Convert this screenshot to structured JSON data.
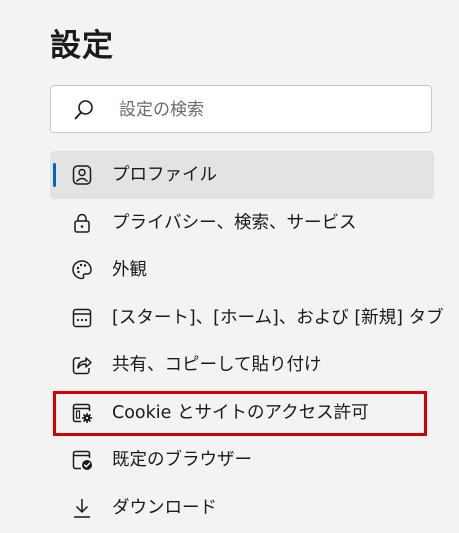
{
  "header": {
    "title": "設定"
  },
  "search": {
    "placeholder": "設定の検索"
  },
  "nav": {
    "items": [
      {
        "label": "プロファイル",
        "icon": "profile-icon",
        "selected": true
      },
      {
        "label": "プライバシー、検索、サービス",
        "icon": "lock-icon"
      },
      {
        "label": "外観",
        "icon": "palette-icon"
      },
      {
        "label": "[スタート]、[ホーム]、および [新規] タブ",
        "icon": "start-page-icon"
      },
      {
        "label": "共有、コピーして貼り付け",
        "icon": "share-icon"
      },
      {
        "label": "Cookie とサイトのアクセス許可",
        "icon": "site-permissions-icon",
        "highlighted": true
      },
      {
        "label": "既定のブラウザー",
        "icon": "default-browser-icon"
      },
      {
        "label": "ダウンロード",
        "icon": "download-icon"
      }
    ]
  },
  "colors": {
    "accent": "#0067c0",
    "highlight_border": "#d20000",
    "selected_bg": "#e3e3e3",
    "page_bg": "#f3f3f3"
  }
}
